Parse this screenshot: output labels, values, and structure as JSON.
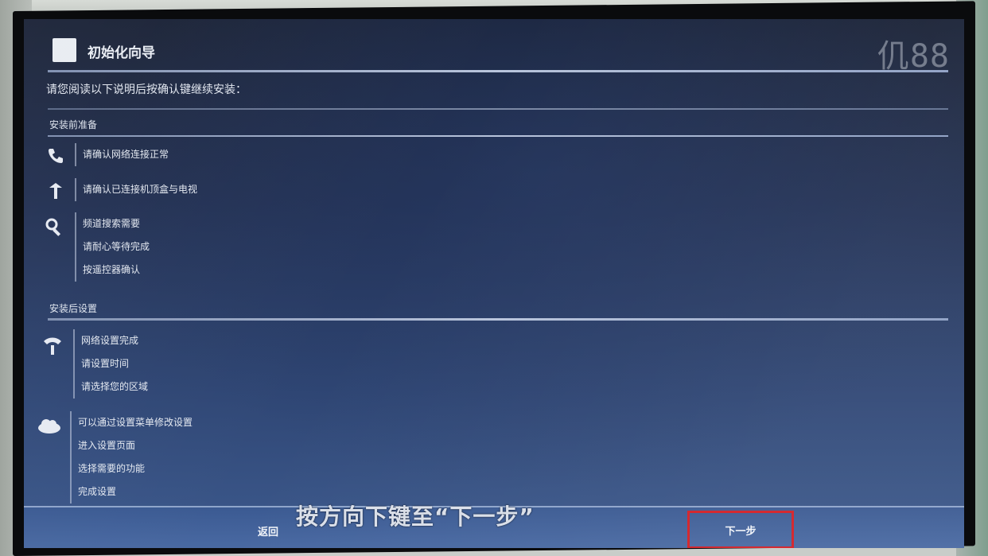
{
  "window": {
    "title": "初始化向导",
    "clock": "仉88"
  },
  "intro": {
    "text": "请您阅读以下说明后按确认键继续安装："
  },
  "sections": [
    {
      "label": "安装前准备",
      "rows": [
        {
          "icon": "phone-icon",
          "lines": [
            "请确认网络连接正常"
          ]
        },
        {
          "icon": "antenna-icon",
          "lines": [
            "请确认已连接机顶盒与电视"
          ]
        },
        {
          "icon": "search-icon",
          "lines": [
            "频道搜索需要",
            "请耐心等待完成",
            "按遥控器确认"
          ]
        }
      ]
    },
    {
      "label": "安装后设置",
      "rows": [
        {
          "icon": "wifi-icon",
          "lines": [
            "网络设置完成",
            "请设置时间",
            "请选择您的区域"
          ]
        },
        {
          "icon": "cloud-icon",
          "lines": [
            "可以通过设置菜单修改设置",
            "进入设置页面",
            "选择需要的功能",
            "完成设置"
          ]
        }
      ]
    }
  ],
  "footer": {
    "back_label": "返回",
    "next_label": "下一步"
  },
  "caption": {
    "text": "按方向下键至“下一步”"
  },
  "colors": {
    "highlight_box": "#d21f26",
    "screen_dark": "#1a2236",
    "screen_light": "#3d5a8e"
  }
}
